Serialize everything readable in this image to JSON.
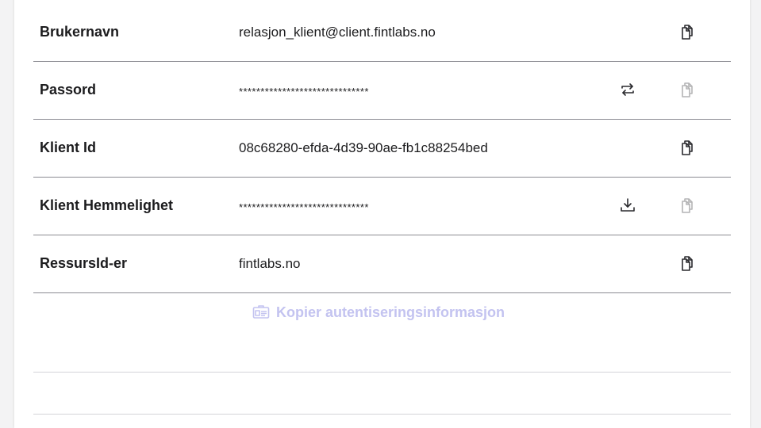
{
  "rows": [
    {
      "label": "Brukernavn",
      "value": "relasjon_klient@client.fintlabs.no",
      "copy_enabled": true
    },
    {
      "label": "Passord",
      "value": "******************************",
      "action_icon": "refresh-icon",
      "copy_enabled": false
    },
    {
      "label": "Klient Id",
      "value": "08c68280-efda-4d39-90ae-fb1c88254bed",
      "copy_enabled": true
    },
    {
      "label": "Klient Hemmelighet",
      "value": "******************************",
      "action_icon": "download-icon",
      "copy_enabled": false
    },
    {
      "label": "RessursId-er",
      "value": "fintlabs.no",
      "copy_enabled": true
    }
  ],
  "copy_all": {
    "label": "Kopier autentiseringsinformasjon",
    "icon": "id-card-icon",
    "enabled": false
  },
  "colors": {
    "text": "#1c1c1e",
    "divider": "#8b8b92",
    "disabled_accent": "#c3c3f0"
  }
}
